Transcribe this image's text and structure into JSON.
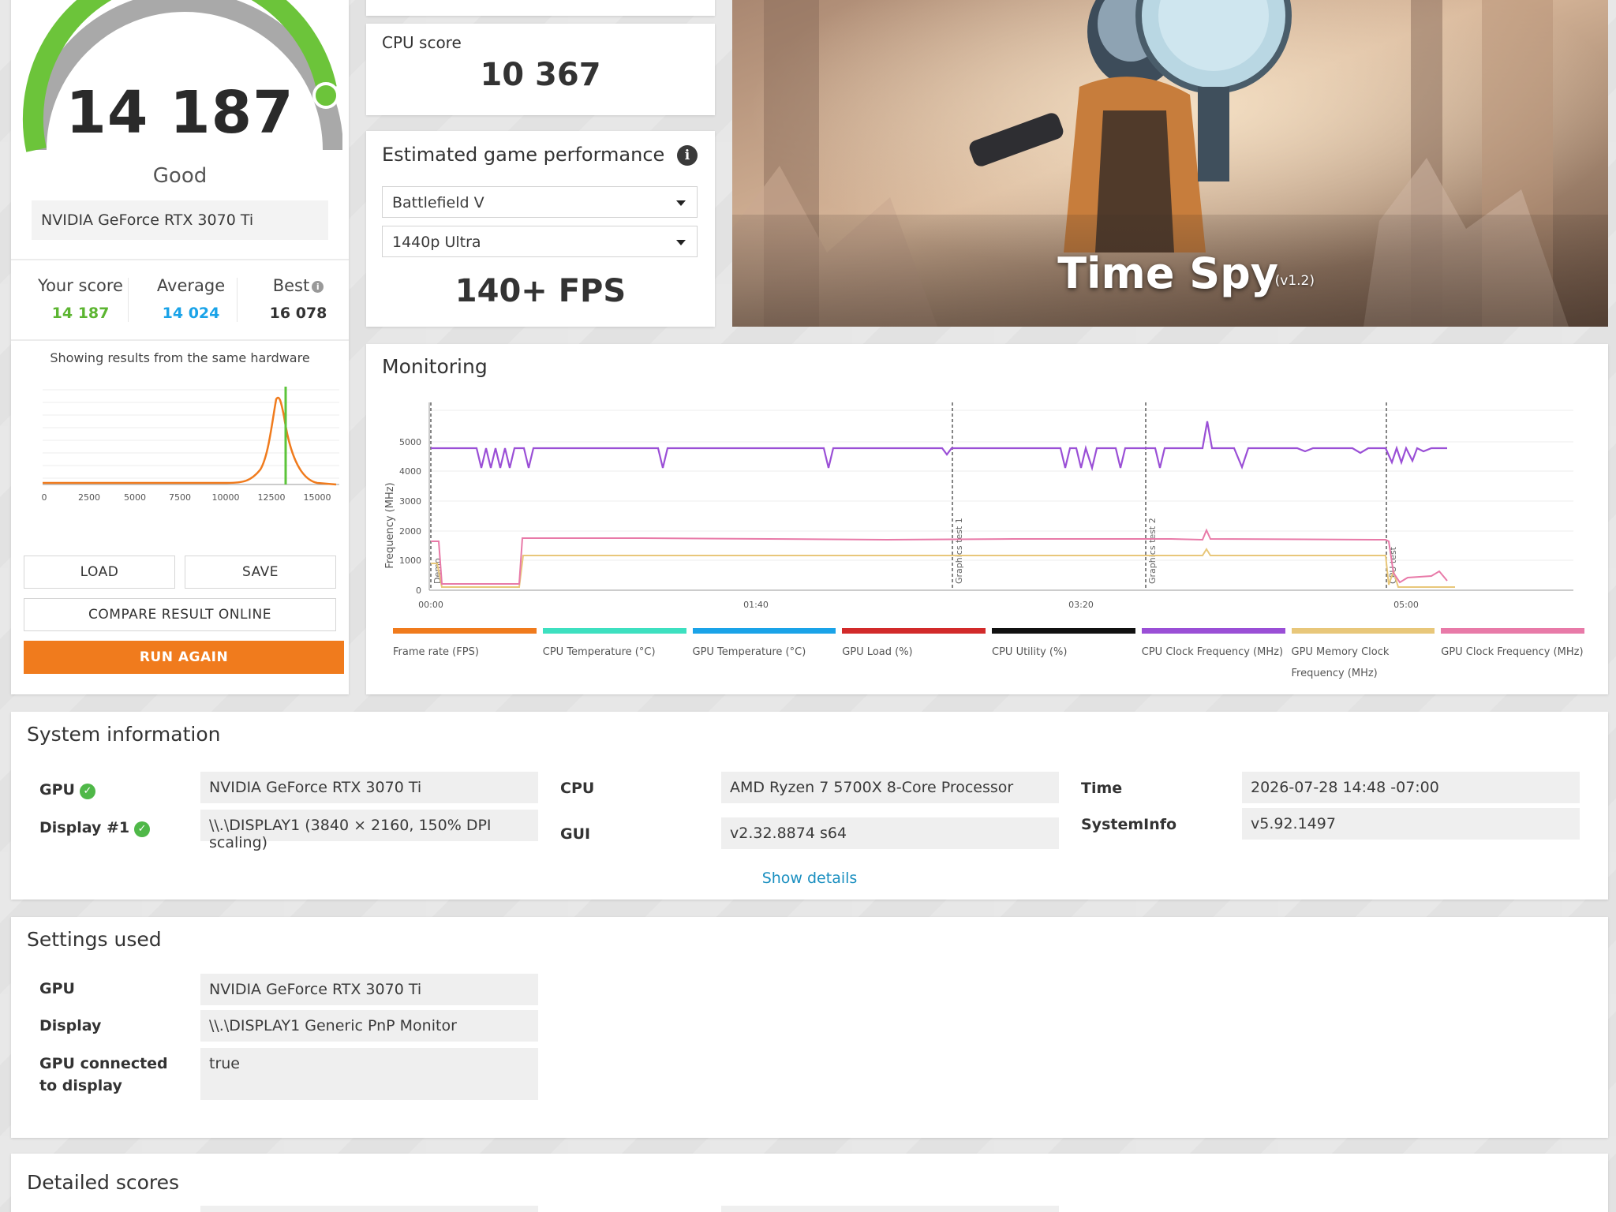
{
  "score": {
    "value": "14 187",
    "rating": "Good",
    "gpu": "NVIDIA GeForce RTX 3070 Ti",
    "your_score_label": "Your score",
    "your_score": "14 187",
    "average_label": "Average",
    "average": "14 024",
    "best_label": "Best",
    "best": "16 078",
    "same_hardware": "Showing results from the same hardware",
    "dist_ticks": [
      "0",
      "2500",
      "5000",
      "7500",
      "10000",
      "12500",
      "15000"
    ],
    "buttons": {
      "load": "LOAD",
      "save": "SAVE",
      "compare": "COMPARE RESULT ONLINE",
      "run_again": "RUN AGAIN"
    }
  },
  "cpu": {
    "label": "CPU score",
    "value": "10 367"
  },
  "egp": {
    "title": "Estimated game performance",
    "game": "Battlefield V",
    "preset": "1440p Ultra",
    "fps": "140+ FPS"
  },
  "hero": {
    "title": "Time Spy",
    "version": "(v1.2)"
  },
  "monitoring": {
    "title": "Monitoring",
    "ylabel": "Frequency (MHz)",
    "yticks": [
      "5000",
      "4000",
      "3000",
      "2000",
      "1000",
      "0"
    ],
    "xticks": [
      "00:00",
      "01:40",
      "03:20",
      "05:00"
    ],
    "markers": [
      "Demo",
      "Graphics test 1",
      "Graphics test 2",
      "CPU test"
    ],
    "legend": [
      {
        "label": "Frame rate (FPS)",
        "color": "#f07b1d"
      },
      {
        "label": "CPU Temperature (°C)",
        "color": "#3de0c0"
      },
      {
        "label": "GPU Temperature (°C)",
        "color": "#1aa3e8"
      },
      {
        "label": "GPU Load (%)",
        "color": "#d22a2a"
      },
      {
        "label": "CPU Utility (%)",
        "color": "#111111"
      },
      {
        "label": "CPU Clock Frequency (MHz)",
        "color": "#9a4fd6"
      },
      {
        "label": "GPU Memory Clock Frequency (MHz)",
        "color": "#e8c77a"
      },
      {
        "label": "GPU Clock Frequency (MHz)",
        "color": "#e87aa8"
      }
    ]
  },
  "sysinfo": {
    "title": "System information",
    "gpu_label": "GPU",
    "gpu": "NVIDIA GeForce RTX 3070 Ti",
    "display_label": "Display #1",
    "display": "\\\\.\\DISPLAY1 (3840 × 2160, 150% DPI scaling)",
    "cpu_label": "CPU",
    "cpu": "AMD Ryzen 7 5700X 8-Core Processor",
    "gui_label": "GUI",
    "gui": "v2.32.8874 s64",
    "time_label": "Time",
    "time": "2026-07-28 14:48 -07:00",
    "systeminfo_label": "SystemInfo",
    "systeminfo": "v5.92.1497",
    "show_details": "Show details"
  },
  "settings": {
    "title": "Settings used",
    "gpu_label": "GPU",
    "gpu": "NVIDIA GeForce RTX 3070 Ti",
    "display_label": "Display",
    "display": "\\\\.\\DISPLAY1 Generic PnP Monitor",
    "connected_label": "GPU connected to display",
    "connected": "true"
  },
  "detailed": {
    "title": "Detailed scores"
  }
}
